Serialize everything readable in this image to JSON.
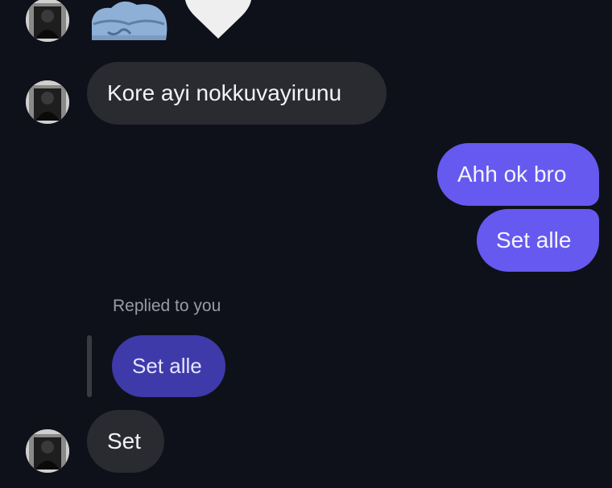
{
  "messages": {
    "received_1": {
      "text": "Kore ayi nokkuvayirunu"
    },
    "sent_1": {
      "text": "Ahh ok bro"
    },
    "sent_2": {
      "text": "Set alle"
    },
    "reply_label": "Replied to you",
    "quoted_reply": {
      "text": "Set alle"
    },
    "received_2": {
      "text": "Set"
    }
  },
  "sticker": {
    "icon": "cake-sticker-icon"
  },
  "heart": {
    "icon": "heart-icon"
  },
  "colors": {
    "background": "#0f111a",
    "received_bubble": "#2a2b31",
    "sent_bubble": "#6659ef",
    "quoted_bubble": "#3e3aa9",
    "muted_text": "#9a9ba4"
  }
}
